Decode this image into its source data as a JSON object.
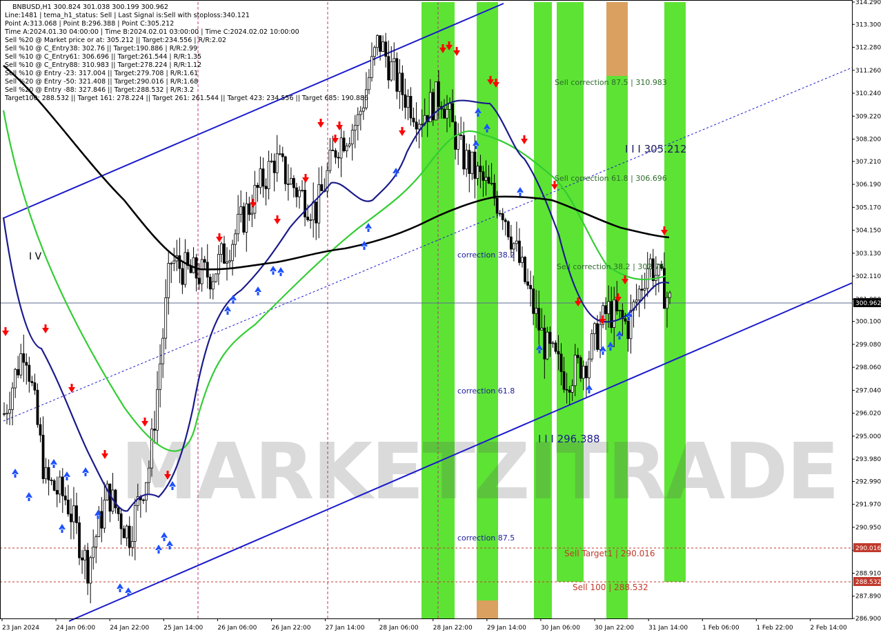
{
  "info_panel": {
    "lines": [
      "BNBUSD,H1  300.824 301.038 300.199 300.962",
      "Line:1481 | tema_h1_status: Sell | Last Signal is:Sell with stoploss:340.121",
      "Point A:313.068 | Point B:296.388 | Point C:305.212",
      "Time A:2024.01.30 04:00:00 | Time B:2024.02.01 03:00:00 | Time C:2024.02.02 10:00:00",
      "Sell %20 @ Market price or at: 305.212 || Target:234.556 | R/R:2.02",
      "Sell %10 @ C_Entry38: 302.76 || Target:190.886 | R/R:2.99",
      "Sell %10 @ C_Entry61: 306.696 || Target:261.544 | R/R:1.35",
      "Sell %10 @ C_Entry88: 310.983 || Target:278.224 | R/R:1.12",
      "Sell %10 @ Entry -23: 317.004 || Target:279.708 | R/R:1.61",
      "Sell %20 @ Entry -50: 321.408 || Target:290.016 | R/R:1.68",
      "Sell %20 @ Entry -88: 327.846 || Target:288.532 | R/R:3.2",
      "Target100: 288.532 || Target 161: 278.224 || Target 261: 261.544 || Target 423: 234.556 || Target 685: 190.886"
    ]
  },
  "watermark": {
    "text": "MARKETZITRADE",
    "letters": [
      "M",
      "A",
      "R",
      "K",
      "E",
      "T",
      "Z",
      "I",
      "T",
      "R",
      "A",
      "D",
      "E"
    ]
  },
  "wave_label": "I V",
  "levels": {
    "point_c": "I I I 305.212",
    "point_b": "I I I 296.388",
    "sell_correction_875": "Sell correction 87.5 | 310.983",
    "sell_correction_618": "Sell correction 61.8 | 306.696",
    "sell_correction_382": "Sell correction 38.2 | 302.76",
    "correction_382": "correction 38.2",
    "correction_618": "correction 61.8",
    "correction_875": "correction 87.5",
    "sell_target1": "Sell Target1 | 290.016",
    "sell_100": "Sell 100 | 288.532"
  },
  "price_axis": {
    "ticks": [
      "314.290",
      "313.300",
      "312.280",
      "311.260",
      "310.240",
      "309.220",
      "308.200",
      "307.210",
      "306.190",
      "305.170",
      "304.150",
      "303.130",
      "302.110",
      "301.090",
      "300.100",
      "299.080",
      "298.060",
      "297.040",
      "296.020",
      "295.000",
      "293.980",
      "292.990",
      "291.970",
      "290.950",
      "289.930",
      "288.910",
      "287.890",
      "286.900"
    ],
    "current_price": "300.962",
    "target1_price": "290.016",
    "sell100_price": "288.532"
  },
  "time_axis": {
    "labels": [
      "23 Jan 2024",
      "24 Jan 06:00",
      "24 Jan 22:00",
      "25 Jan 14:00",
      "26 Jan 06:00",
      "26 Jan 22:00",
      "27 Jan 14:00",
      "28 Jan 06:00",
      "28 Jan 22:00",
      "29 Jan 14:00",
      "30 Jan 06:00",
      "30 Jan 22:00",
      "31 Jan 14:00",
      "1 Feb 06:00",
      "1 Feb 22:00",
      "2 Feb 14:00"
    ]
  },
  "colors": {
    "bull_candle": "#000000",
    "bear_candle": "#000000",
    "channel": "#0000cd",
    "ma_black": "#000000",
    "ma_navy": "#1a1a8c",
    "ma_green": "#32cd32",
    "band_green": "#4be01e",
    "band_orange": "#d9a060",
    "sell_arrow": "#ff0000",
    "buy_arrow": "#1e50ff",
    "level_red": "#c0392b",
    "current_price_line": "#5a6e8c"
  },
  "chart_data": {
    "type": "candlestick",
    "symbol": "BNBUSD",
    "timeframe": "H1",
    "ohlc_last": {
      "open": 300.824,
      "high": 301.038,
      "low": 300.199,
      "close": 300.962
    },
    "ylim": [
      286.9,
      314.29
    ],
    "x_time_labels": [
      "23 Jan 2024",
      "24 Jan 06:00",
      "24 Jan 22:00",
      "25 Jan 14:00",
      "26 Jan 06:00",
      "26 Jan 22:00",
      "27 Jan 14:00",
      "28 Jan 06:00",
      "28 Jan 22:00",
      "29 Jan 14:00",
      "30 Jan 06:00",
      "30 Jan 22:00",
      "31 Jan 14:00",
      "1 Feb 06:00",
      "1 Feb 22:00",
      "2 Feb 14:00"
    ],
    "close_path": [
      {
        "t": 0,
        "v": 296.0
      },
      {
        "t": 1,
        "v": 299.2
      },
      {
        "t": 2,
        "v": 293.0
      },
      {
        "t": 3,
        "v": 292.2
      },
      {
        "t": 4,
        "v": 289.2
      },
      {
        "t": 5,
        "v": 292.5
      },
      {
        "t": 6,
        "v": 290.6
      },
      {
        "t": 7,
        "v": 293.8
      },
      {
        "t": 8,
        "v": 302.8
      },
      {
        "t": 9,
        "v": 302.2
      },
      {
        "t": 10,
        "v": 302.2
      },
      {
        "t": 11,
        "v": 303.8
      },
      {
        "t": 12,
        "v": 305.6
      },
      {
        "t": 13,
        "v": 307.3
      },
      {
        "t": 14,
        "v": 306.0
      },
      {
        "t": 15,
        "v": 305.0
      },
      {
        "t": 16,
        "v": 308.0
      },
      {
        "t": 17,
        "v": 309.0
      },
      {
        "t": 18,
        "v": 312.6
      },
      {
        "t": 19,
        "v": 310.5
      },
      {
        "t": 20,
        "v": 309.2
      },
      {
        "t": 21,
        "v": 310.2
      },
      {
        "t": 22,
        "v": 307.5
      },
      {
        "t": 23,
        "v": 306.3
      },
      {
        "t": 24,
        "v": 305.1
      },
      {
        "t": 25,
        "v": 302.0
      },
      {
        "t": 26,
        "v": 299.0
      },
      {
        "t": 27,
        "v": 297.6
      },
      {
        "t": 28,
        "v": 298.4
      },
      {
        "t": 29,
        "v": 300.6
      },
      {
        "t": 30,
        "v": 299.9
      },
      {
        "t": 31,
        "v": 302.8
      },
      {
        "t": 32,
        "v": 300.96
      }
    ],
    "series": [
      {
        "name": "tema_h1",
        "values": [
          299.0,
          296.5,
          294.5,
          292.0,
          290.8,
          292.5,
          299.5,
          303.0,
          304.5,
          306.0,
          308.5,
          310.0,
          310.2,
          307.0,
          304.0,
          300.5,
          300.2,
          302.0
        ]
      },
      {
        "values": [
          309.5,
          302.5,
          295.0,
          294.2,
          298.5,
          303.0,
          305.5,
          307.8,
          308.5,
          306.3,
          303.0,
          302.0
        ]
      },
      {
        "values": [
          311.0,
          306.5,
          303.0,
          302.0,
          302.3,
          303.3,
          304.8,
          305.2,
          305.0,
          304.2,
          304.0
        ]
      }
    ],
    "channel": {
      "upper_start": [
        0,
        305.2
      ],
      "upper_end": [
        24,
        314.29
      ],
      "lower_start": [
        3,
        286.9
      ],
      "lower_end": [
        33,
        302.2
      ]
    },
    "levels": {
      "point_a": 313.068,
      "point_b": 296.388,
      "point_c": 305.212,
      "target1": 290.016,
      "sell100": 288.532,
      "current": 300.962
    }
  }
}
